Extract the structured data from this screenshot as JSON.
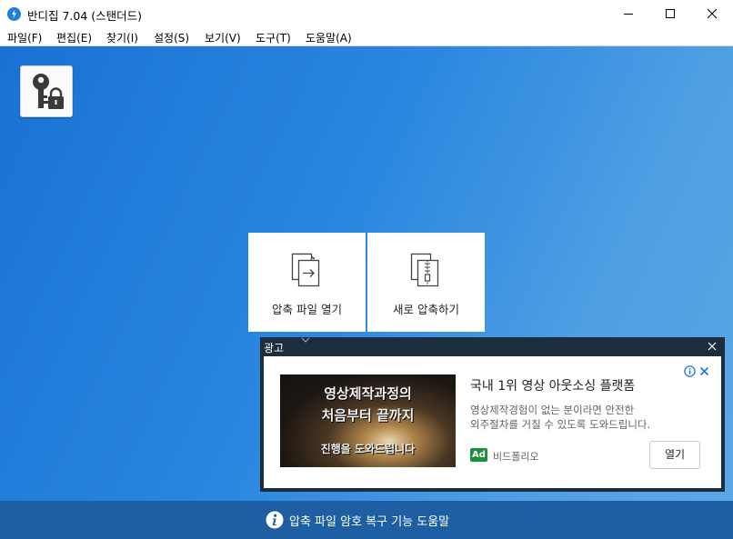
{
  "window": {
    "title": "반디집 7.04 (스탠더드)"
  },
  "menu": [
    {
      "label": "파일(F)"
    },
    {
      "label": "편집(E)"
    },
    {
      "label": "찾기(I)"
    },
    {
      "label": "설정(S)"
    },
    {
      "label": "보기(V)"
    },
    {
      "label": "도구(T)"
    },
    {
      "label": "도움말(A)"
    }
  ],
  "toolbar": {
    "password_button_icon": "key-lock-icon"
  },
  "tiles": {
    "open": {
      "label": "압축 파일 열기",
      "icon": "open-archive-icon"
    },
    "new": {
      "label": "새로 압축하기",
      "icon": "new-archive-icon"
    }
  },
  "ad": {
    "header": "광고",
    "image_lines": [
      "영상제작과정의",
      "처음부터 끝까지",
      "진행을 도와드립니다"
    ],
    "title": "국내 1위 영상 아웃소싱 플랫폼",
    "description_line1": "영상제작경험이 없는 분이라면 안전한",
    "description_line2": "외주절차를 거칠 수 있도록 도와드립니다.",
    "badge": "Ad",
    "advertiser": "비드폴리오",
    "cta": "열기"
  },
  "footer": {
    "text": "압축 파일 암호 복구 기능 도움말"
  },
  "colors": {
    "accent": "#1a72d4",
    "footer": "#1d5fa2",
    "ad_frame": "#1c2d3e",
    "ad_badge": "#1e8e3e"
  }
}
